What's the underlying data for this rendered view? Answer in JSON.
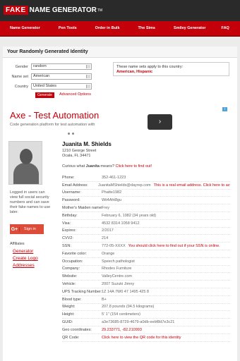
{
  "header": {
    "logo_fake": "FAKE",
    "logo_rest": "NAME GENERATOR",
    "logo_tm": "TM"
  },
  "nav": [
    "Name Generator",
    "Pen Tools",
    "Order in Bulk",
    "The Sims",
    "Smiley Generator",
    "FAQ"
  ],
  "page_title": "Your Randomly Generated Identity",
  "form": {
    "gender_label": "Gender",
    "gender_value": "random",
    "nameset_label": "Name set",
    "nameset_value": "American",
    "country_label": "Country",
    "country_value": "United States",
    "generate_label": "Generate",
    "advanced_label": "Advanced Options"
  },
  "apply": {
    "text": "These name sets apply to this country:",
    "value": "American, Hispanic"
  },
  "ad": {
    "title": "Axe - Test Automation",
    "subtitle": "Code generation platform for test automation with",
    "arrow": "›",
    "info": "i"
  },
  "person": {
    "name": "Juanita M. Shields",
    "addr1": "1210 George Street",
    "addr2": "Ocala, FL 34471",
    "curious_prefix": "Curious what ",
    "curious_name": "Juanita",
    "curious_mid": " means? ",
    "curious_link": "Click here to find out!"
  },
  "signup": {
    "text": "Logged in users can view full social security numbers and can save their fake names to use later.",
    "gplus_g": "G+",
    "gplus_label": "Sign in"
  },
  "links": {
    "heading": "Affiliates",
    "items": [
      "Generator",
      "Create Logo",
      "Addresses"
    ]
  },
  "details": [
    {
      "label": "Phone:",
      "value": "352-461-1223"
    },
    {
      "label": "Email Address:",
      "value": "JuanitaMShields@dayrep.com",
      "extra": "This is a real email address. Click here to activate it!"
    },
    {
      "label": "Username:",
      "value": "Phatte1982"
    },
    {
      "label": "Password:",
      "value": "Wii4Aht8gu"
    },
    {
      "label": "Mother's Maiden name:",
      "value": "Frey"
    },
    {
      "label": "Birthday:",
      "value": "February 6, 1982 (34 years old)"
    },
    {
      "label": "Visa:",
      "value": "4532 8314 1058 9412"
    },
    {
      "label": "Expires:",
      "value": "2/2017"
    },
    {
      "label": "CVV2:",
      "value": "214"
    },
    {
      "label": "SSN:",
      "value": "772-05-XXXX",
      "extra": "You should click here to find out if your SSN is online."
    },
    {
      "label": "Favorite color:",
      "value": "Orange"
    },
    {
      "label": "Occupation:",
      "value": "Speech pathologist"
    },
    {
      "label": "Company:",
      "value": "Rhodes Furniture"
    },
    {
      "label": "Website:",
      "value": "ValleyCentre.com"
    },
    {
      "label": "Vehicle:",
      "value": "2007 Suzuki Jimny"
    },
    {
      "label": "UPS Tracking Number:",
      "value": "1Z 14A 7W0 47 1495 425 8"
    },
    {
      "label": "Blood type:",
      "value": "B+"
    },
    {
      "label": "Weight:",
      "value": "207.8 pounds (94.5 kilograms)"
    },
    {
      "label": "Height:",
      "value": "5' 1\" (154 centimeters)"
    },
    {
      "label": "GUID:",
      "value": "a3e73685-8729-4679-a0db-eebf8d7e3c21"
    },
    {
      "label": "Geo coordinates:",
      "value": "29.233771, -82.210993",
      "red": true
    },
    {
      "label": "QR Code:",
      "value": "Click here to view the QR code for this identity",
      "red": true
    }
  ]
}
